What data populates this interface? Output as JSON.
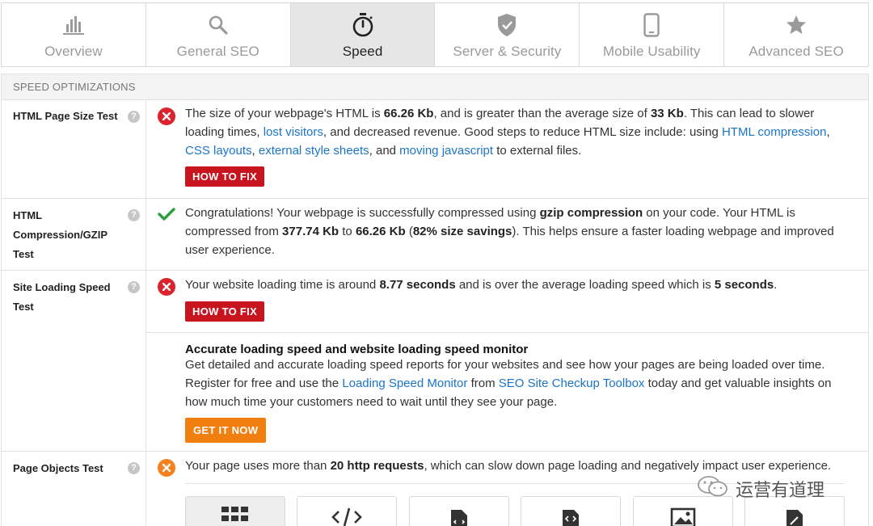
{
  "tabs": [
    {
      "label": "Overview",
      "icon": "bar-chart-icon",
      "active": false
    },
    {
      "label": "General SEO",
      "icon": "search-icon",
      "active": false
    },
    {
      "label": "Speed",
      "icon": "stopwatch-icon",
      "active": true
    },
    {
      "label": "Server & Security",
      "icon": "shield-icon",
      "active": false
    },
    {
      "label": "Mobile Usability",
      "icon": "mobile-phone-icon",
      "active": false
    },
    {
      "label": "Advanced SEO",
      "icon": "star-icon",
      "active": false
    }
  ],
  "section": {
    "title": "SPEED OPTIMIZATIONS"
  },
  "html_size": {
    "label": "HTML Page Size Test",
    "status": "fail",
    "t1": "The size of your webpage's HTML is ",
    "size": "66.26 Kb",
    "t2": ", and is greater than the average size of ",
    "avg": "33 Kb",
    "t3": ". This can lead to slower loading times, ",
    "link_lost_visitors": "lost visitors",
    "t4": ", and decreased revenue. Good steps to reduce HTML size include: using ",
    "link_html_compression": "HTML compression",
    "t5": ", ",
    "link_css_layouts": "CSS layouts",
    "t6": ", ",
    "link_external_styles": "external style sheets",
    "t7": ", and ",
    "link_moving_js": "moving javascript",
    "t8": " to external files.",
    "button": "HOW TO FIX"
  },
  "gzip": {
    "label": "HTML Compression/GZIP Test",
    "status": "pass",
    "t1": "Congratulations! Your webpage is successfully compressed using ",
    "b1": "gzip compression",
    "t2": " on your code. Your HTML is compressed from ",
    "b2": "377.74 Kb",
    "t3": " to ",
    "b3": "66.26 Kb",
    "t4": " (",
    "b4": "82% size savings",
    "t5": "). This helps ensure a faster loading webpage and improved user experience."
  },
  "loading": {
    "label": "Site Loading Speed Test",
    "status": "fail",
    "t1": "Your website loading time is around ",
    "b1": "8.77 seconds",
    "t2": " and is over the average loading speed which is ",
    "b2": "5 seconds",
    "t3": ".",
    "button": "HOW TO FIX",
    "promo_title": "Accurate loading speed and website loading speed monitor",
    "p1": "Get detailed and accurate loading speed reports for your websites and see how your pages are being loaded over time. Register for free and use the ",
    "link_monitor": "Loading Speed Monitor",
    "p2": " from ",
    "link_toolbox": "SEO Site Checkup Toolbox",
    "p3": " today and get valuable insights on how much time your customers need to wait until they see your page.",
    "promo_button": "GET IT NOW"
  },
  "objects": {
    "label": "Page Objects Test",
    "status": "warn",
    "t1": "Your page uses more than ",
    "b1": "20 http requests",
    "t2": ", which can slow down page loading and negatively impact user experience.",
    "cards": [
      "grid-icon",
      "code-icon",
      "file-code-icon",
      "script-file-icon",
      "image-icon",
      "edit-file-icon"
    ]
  },
  "watermark": {
    "text": "运营有道理"
  },
  "colors": {
    "fail": "#d9232d",
    "warn": "#f5821f",
    "pass": "#2e9e3e",
    "link": "#1a75c9",
    "fix_button": "#c8141f",
    "get_button": "#f07f10"
  }
}
